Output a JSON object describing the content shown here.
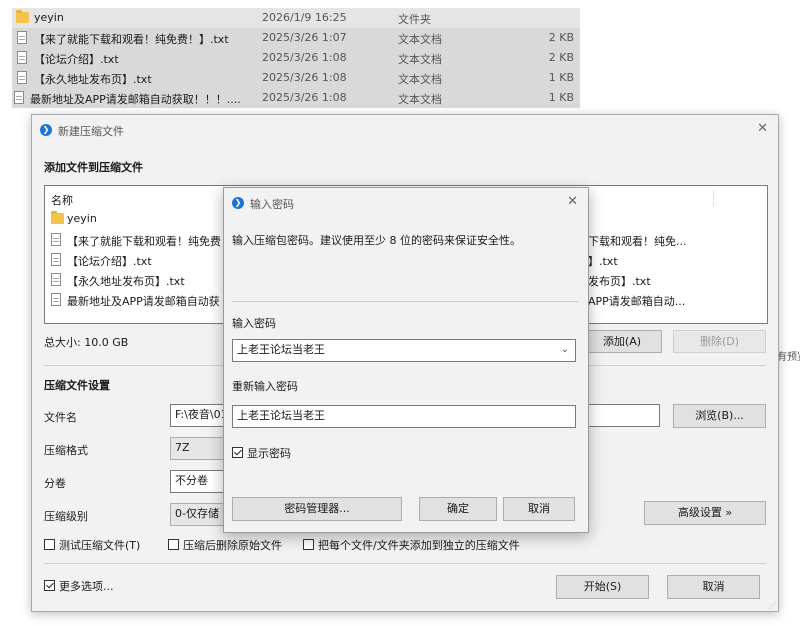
{
  "explorer": {
    "rows": [
      {
        "name": "yeyin",
        "date": "2026/1/9 16:25",
        "type": "文件夹",
        "size": "",
        "icon": "folder-icon"
      },
      {
        "name": "【来了就能下载和观看！纯免费！】.txt",
        "date": "2025/3/26 1:07",
        "type": "文本文档",
        "size": "2 KB",
        "icon": "text-file-icon"
      },
      {
        "name": "【论坛介绍】.txt",
        "date": "2025/3/26 1:08",
        "type": "文本文档",
        "size": "2 KB",
        "icon": "text-file-icon"
      },
      {
        "name": "【永久地址发布页】.txt",
        "date": "2025/3/26 1:08",
        "type": "文本文档",
        "size": "1 KB",
        "icon": "text-file-icon"
      },
      {
        "name": "最新地址及APP请发邮箱自动获取！！！....",
        "date": "2025/3/26 1:08",
        "type": "文本文档",
        "size": "1 KB",
        "icon": "text-file-icon"
      }
    ],
    "side_text": "有预览"
  },
  "main_dialog": {
    "title": "新建压缩文件",
    "close": "✕",
    "add_section": "添加文件到压缩文件",
    "list_header": "名称",
    "list_items": [
      "yeyin",
      "【来了就能下载和观看！纯免费",
      "【论坛介绍】.txt",
      "【永久地址发布页】.txt",
      "最新地址及APP请发邮箱自动获"
    ],
    "list_right": [
      "下载和观看！纯免...",
      "】.txt",
      "发布页】.txt",
      "APP请发邮箱自动..."
    ],
    "total_size": "总大小: 10.0 GB",
    "add_button": "添加(A)",
    "delete_button": "删除(D)",
    "settings_title": "压缩文件设置",
    "filename_label": "文件名",
    "filename_value": "F:\\夜音\\01",
    "browse_button": "浏览(B)...",
    "format_label": "压缩格式",
    "format_value": "7Z",
    "volume_label": "分卷",
    "volume_value": "不分卷",
    "level_label": "压缩级别",
    "level_value": "0-仅存储",
    "advanced_button": "高级设置 »",
    "test_checkbox": "测试压缩文件(T)",
    "delete_after_checkbox": "压缩后删除原始文件",
    "separate_checkbox": "把每个文件/文件夹添加到独立的压缩文件",
    "more_options_checkbox": "更多选项...",
    "start_button": "开始(S)",
    "cancel_button": "取消"
  },
  "password_dialog": {
    "title": "输入密码",
    "close": "✕",
    "description": "输入压缩包密码。建议使用至少 8 位的密码来保证安全性。",
    "password_label": "输入密码",
    "password_value": "上老王论坛当老王",
    "confirm_label": "重新输入密码",
    "confirm_value": "上老王论坛当老王",
    "show_password": "显示密码",
    "manager_button": "密码管理器...",
    "ok_button": "确定",
    "cancel_button": "取消"
  },
  "colors": {
    "accent": "#1e74d4",
    "dialog_bg": "#f2f2f2",
    "selection": "#d9d9d9"
  }
}
